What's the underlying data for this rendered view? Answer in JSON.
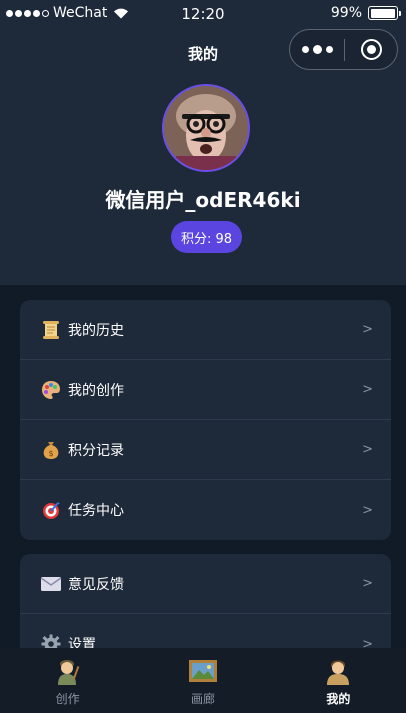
{
  "status_bar": {
    "carrier": "WeChat",
    "time": "12:20",
    "battery": "99%",
    "battery_level": 0.99
  },
  "nav": {
    "title": "我的"
  },
  "profile": {
    "username": "微信用户_odER46ki",
    "points_badge": "积分: 98"
  },
  "menu_primary": [
    {
      "label": "我的历史",
      "icon": "scroll-icon",
      "arrow": ">"
    },
    {
      "label": "我的创作",
      "icon": "palette-icon",
      "arrow": ">"
    },
    {
      "label": "积分记录",
      "icon": "money-bag-icon",
      "arrow": ">"
    },
    {
      "label": "任务中心",
      "icon": "target-icon",
      "arrow": ">"
    }
  ],
  "menu_secondary": [
    {
      "label": "意见反馈",
      "icon": "envelope-icon",
      "arrow": ">"
    },
    {
      "label": "设置",
      "icon": "gear-icon",
      "arrow": ">"
    }
  ],
  "tabbar": [
    {
      "label": "创作",
      "icon": "painter-icon",
      "active": false
    },
    {
      "label": "画廊",
      "icon": "framed-picture-icon",
      "active": false
    },
    {
      "label": "我的",
      "icon": "person-icon",
      "active": true
    }
  ],
  "colors": {
    "accent": "#5a45e0",
    "header_bg": "#1e2a3a",
    "page_bg": "#111a27",
    "card_bg": "#1e2a3a"
  }
}
